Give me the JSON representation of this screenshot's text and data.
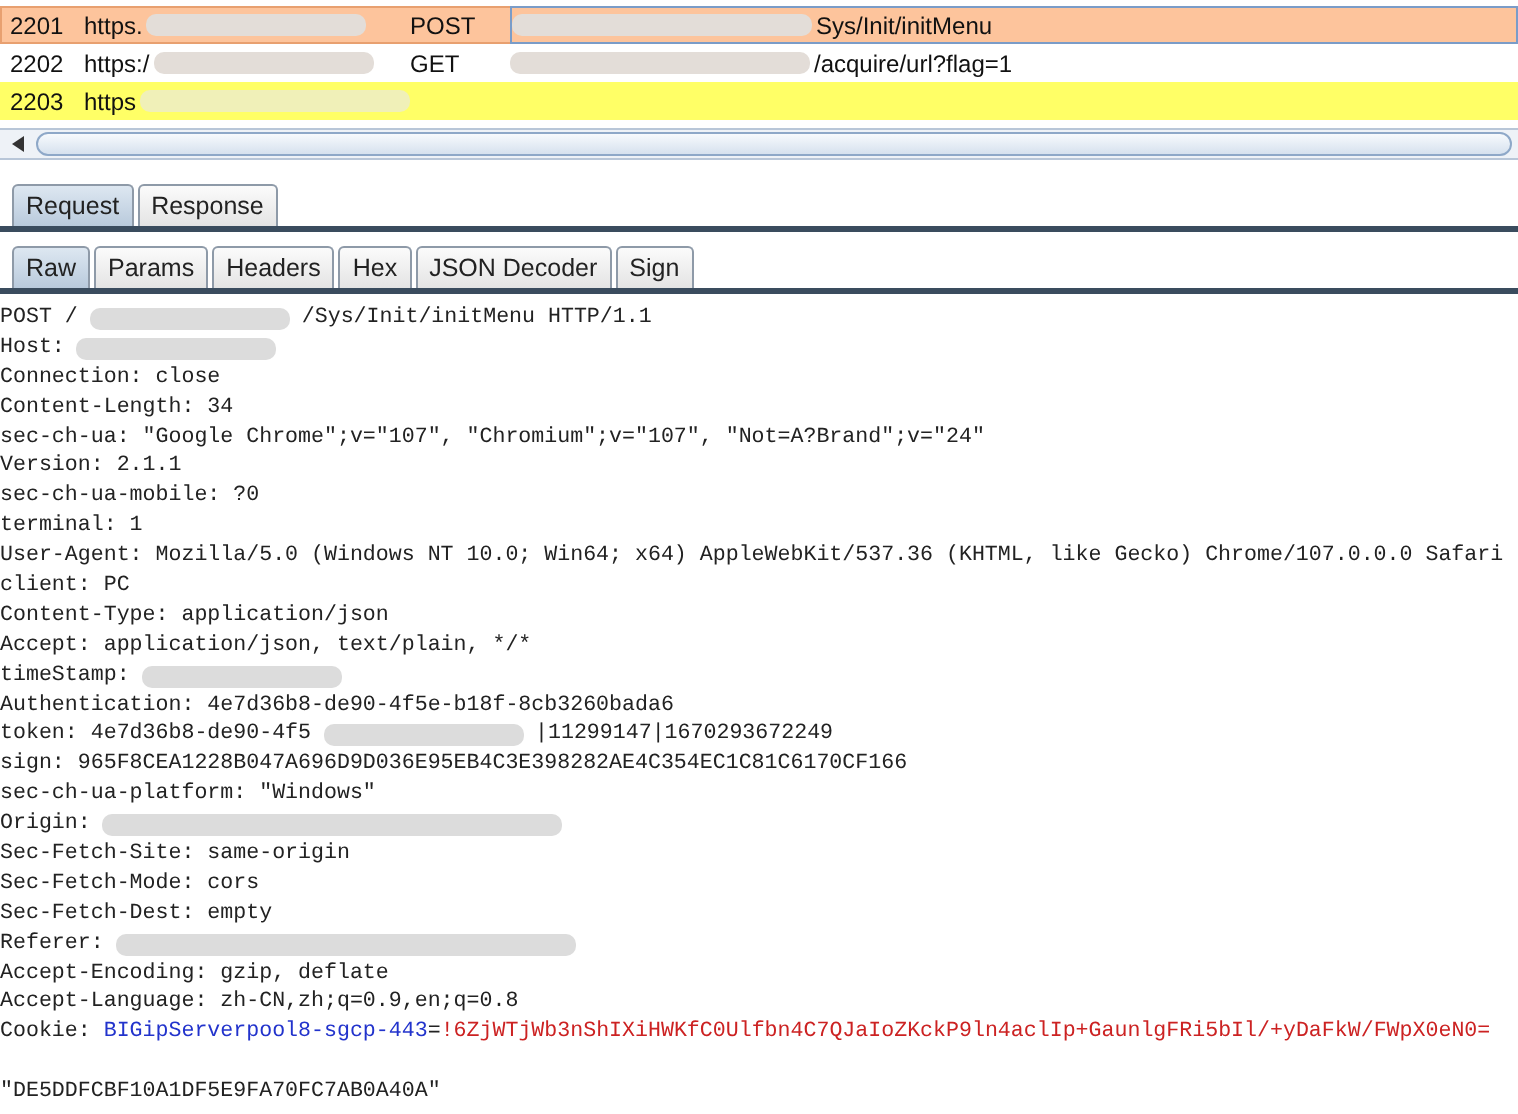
{
  "history": {
    "rows": [
      {
        "number": "2201",
        "host": "https.",
        "method": "POST",
        "url": "Sys/Init/initMenu",
        "selected": true,
        "color": "#fdc49c"
      },
      {
        "number": "2202",
        "host": "https:/",
        "method": "GET",
        "url": "/acquire/url?flag=1",
        "selected": false,
        "color": "#ffffff"
      },
      {
        "number": "2203",
        "host": "https",
        "selected": false,
        "color": "#ffff66"
      }
    ]
  },
  "message_tabs": [
    {
      "label": "Request",
      "selected": true
    },
    {
      "label": "Response",
      "selected": false
    }
  ],
  "view_tabs": [
    {
      "label": "Raw",
      "selected": true
    },
    {
      "label": "Params",
      "selected": false
    },
    {
      "label": "Headers",
      "selected": false
    },
    {
      "label": "Hex",
      "selected": false
    },
    {
      "label": "JSON Decoder",
      "selected": false
    },
    {
      "label": "Sign",
      "selected": false
    }
  ],
  "request_lines": [
    {
      "kind": "line",
      "parts": [
        {
          "kind": "text",
          "text": "POST /"
        },
        {
          "kind": "redacted"
        },
        {
          "kind": "text",
          "text": "/Sys/Init/initMenu HTTP/1.1"
        }
      ]
    },
    {
      "kind": "line",
      "parts": [
        {
          "kind": "text",
          "text": "Host:"
        },
        {
          "kind": "redacted"
        }
      ]
    },
    {
      "kind": "line",
      "parts": [
        {
          "kind": "text",
          "text": "Connection: close"
        }
      ]
    },
    {
      "kind": "line",
      "parts": [
        {
          "kind": "text",
          "text": "Content-Length: 34"
        }
      ]
    },
    {
      "kind": "line",
      "parts": [
        {
          "kind": "text",
          "text": "sec-ch-ua: \"Google Chrome\";v=\"107\", \"Chromium\";v=\"107\", \"Not=A?Brand\";v=\"24\""
        }
      ]
    },
    {
      "kind": "line",
      "parts": [
        {
          "kind": "text",
          "text": "Version: 2.1.1"
        }
      ]
    },
    {
      "kind": "line",
      "parts": [
        {
          "kind": "text",
          "text": "sec-ch-ua-mobile: ?0"
        }
      ]
    },
    {
      "kind": "line",
      "parts": [
        {
          "kind": "text",
          "text": "terminal: 1"
        }
      ]
    },
    {
      "kind": "line",
      "parts": [
        {
          "kind": "text",
          "text": "User-Agent: Mozilla/5.0 (Windows NT 10.0; Win64; x64) AppleWebKit/537.36 (KHTML, like Gecko) Chrome/107.0.0.0 Safari"
        }
      ]
    },
    {
      "kind": "line",
      "parts": [
        {
          "kind": "text",
          "text": "client: PC"
        }
      ]
    },
    {
      "kind": "line",
      "parts": [
        {
          "kind": "text",
          "text": "Content-Type: application/json"
        }
      ]
    },
    {
      "kind": "line",
      "parts": [
        {
          "kind": "text",
          "text": "Accept: application/json, text/plain, */*"
        }
      ]
    },
    {
      "kind": "line",
      "parts": [
        {
          "kind": "text",
          "text": "timeStamp:"
        },
        {
          "kind": "redacted"
        }
      ]
    },
    {
      "kind": "line",
      "parts": [
        {
          "kind": "text",
          "text": "Authentication: 4e7d36b8-de90-4f5e-b18f-8cb3260bada6"
        }
      ]
    },
    {
      "kind": "line",
      "parts": [
        {
          "kind": "text",
          "text": "token: 4e7d36b8-de90-4f5"
        },
        {
          "kind": "redacted"
        },
        {
          "kind": "text",
          "text": "|11299147|1670293672249"
        }
      ]
    },
    {
      "kind": "line",
      "parts": [
        {
          "kind": "text",
          "text": "sign: 965F8CEA1228B047A696D9D036E95EB4C3E398282AE4C354EC1C81C6170CF166"
        }
      ]
    },
    {
      "kind": "line",
      "parts": [
        {
          "kind": "text",
          "text": "sec-ch-ua-platform: \"Windows\""
        }
      ]
    },
    {
      "kind": "line",
      "parts": [
        {
          "kind": "text",
          "text": "Origin:"
        },
        {
          "kind": "redacted_long"
        }
      ]
    },
    {
      "kind": "line",
      "parts": [
        {
          "kind": "text",
          "text": "Sec-Fetch-Site: same-origin"
        }
      ]
    },
    {
      "kind": "line",
      "parts": [
        {
          "kind": "text",
          "text": "Sec-Fetch-Mode: cors"
        }
      ]
    },
    {
      "kind": "line",
      "parts": [
        {
          "kind": "text",
          "text": "Sec-Fetch-Dest: empty"
        }
      ]
    },
    {
      "kind": "line",
      "parts": [
        {
          "kind": "text",
          "text": "Referer:"
        },
        {
          "kind": "redacted_long"
        }
      ]
    },
    {
      "kind": "line",
      "parts": [
        {
          "kind": "text",
          "text": "Accept-Encoding: gzip, deflate"
        }
      ]
    },
    {
      "kind": "line",
      "parts": [
        {
          "kind": "text",
          "text": "Accept-Language: zh-CN,zh;q=0.9,en;q=0.8"
        }
      ]
    },
    {
      "kind": "line",
      "parts": [
        {
          "kind": "text",
          "text": "Cookie: "
        },
        {
          "kind": "cookie_name",
          "text": "BIGipServerpool8-sgcp-443"
        },
        {
          "kind": "text",
          "text": "="
        },
        {
          "kind": "cookie_value",
          "text": "!6ZjWTjWb3nShIXiHWKfC0Ulfbn4C7QJaIoZKckP9ln4aclIp+GaunlgFRi5bIl/+yDaFkW/FWpX0eN0="
        }
      ]
    },
    {
      "kind": "spaced",
      "parts": [
        {
          "kind": "text",
          "text": "\"DE5DDFCBF10A1DF5E9FA70FC7AB0A40A\""
        }
      ]
    }
  ]
}
